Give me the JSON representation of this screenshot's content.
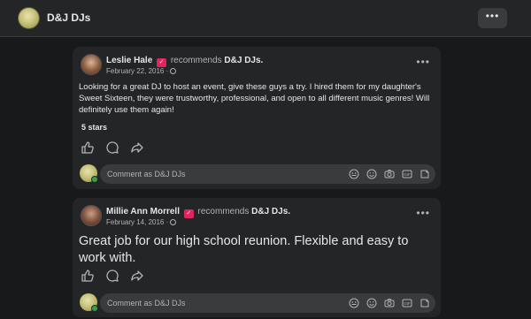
{
  "header": {
    "page_name": "D&J DJs",
    "more_label": "•••"
  },
  "posts": [
    {
      "author": "Leslie Hale",
      "recommends_text": "recommends",
      "target": "D&J DJs.",
      "date": "February 22, 2016 ·",
      "body": "Looking for a great DJ to host an event, give these guys a try. I hired them for my daughter's Sweet Sixteen, they were trustworthy, professional, and open to all different music genres! Will definitely use them again!",
      "rating": "5 stars",
      "more_label": "•••",
      "comment_placeholder": "Comment as D&J DJs"
    },
    {
      "author": "Millie Ann Morrell",
      "recommends_text": "recommends",
      "target": "D&J DJs.",
      "date": "February 14, 2016 ·",
      "body": "Great job for our high school reunion. Flexible and easy to work with.",
      "more_label": "•••",
      "comment_placeholder": "Comment as D&J DJs"
    }
  ],
  "icons": {
    "actions": [
      "like-icon",
      "comment-icon",
      "share-icon"
    ],
    "comment_tools": [
      "avatar-sticker-icon",
      "emoji-icon",
      "camera-icon",
      "gif-icon",
      "sticker-icon"
    ]
  },
  "colors": {
    "background": "#18191a",
    "card": "#242526",
    "input": "#3a3b3c",
    "text": "#e4e6eb",
    "muted": "#b0b3b8",
    "recommend_badge": "#e0245e"
  }
}
